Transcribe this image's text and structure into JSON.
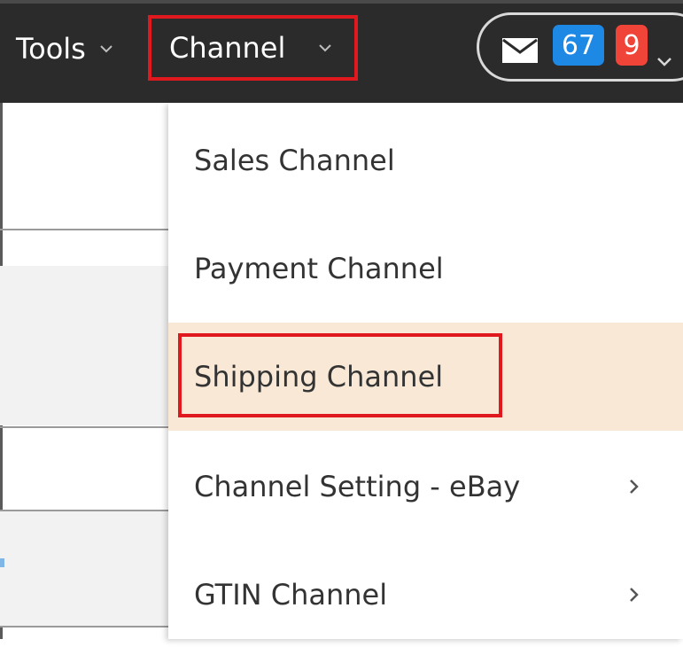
{
  "nav": {
    "tools_label": "Tools",
    "channel_label": "Channel"
  },
  "notifications": {
    "mail_icon": "envelope-icon",
    "count_blue": "67",
    "count_red": "9",
    "blue_color": "#1e88e5",
    "red_color": "#f04438"
  },
  "dropdown": {
    "items": [
      {
        "label": "Sales Channel",
        "has_submenu": false
      },
      {
        "label": "Payment Channel",
        "has_submenu": false
      },
      {
        "label": "Shipping Channel",
        "has_submenu": false,
        "hovered": true
      },
      {
        "label": "Channel Setting - eBay",
        "has_submenu": true
      },
      {
        "label": "GTIN Channel",
        "has_submenu": true
      }
    ]
  },
  "colors": {
    "topbar": "#2b2b2b",
    "highlight": "#e0191f",
    "hover_bg": "#f9e8d6"
  }
}
